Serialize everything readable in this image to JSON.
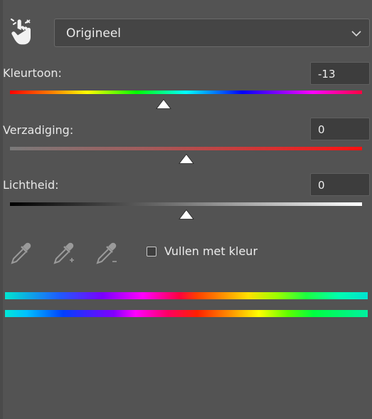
{
  "preset": {
    "value": "Origineel"
  },
  "hue": {
    "label": "Kleurtoon:",
    "value": "-13",
    "position": 0.435
  },
  "saturation": {
    "label": "Verzadiging:",
    "value": "0",
    "position": 0.5
  },
  "lightness": {
    "label": "Lichtheid:",
    "value": "0",
    "position": 0.5
  },
  "colorize": {
    "label": "Vullen met kleur",
    "checked": false
  },
  "icons": {
    "target_adjust": "hand-pointer-icon",
    "eyedropper": "eyedropper-icon",
    "eyedropper_add": "eyedropper-plus-icon",
    "eyedropper_subtract": "eyedropper-minus-icon",
    "dropdown_chevron": "chevron-down-icon"
  },
  "colors": {
    "panel_bg": "#535353",
    "field_bg": "#3d3d3d",
    "text": "#e6e6e6"
  }
}
